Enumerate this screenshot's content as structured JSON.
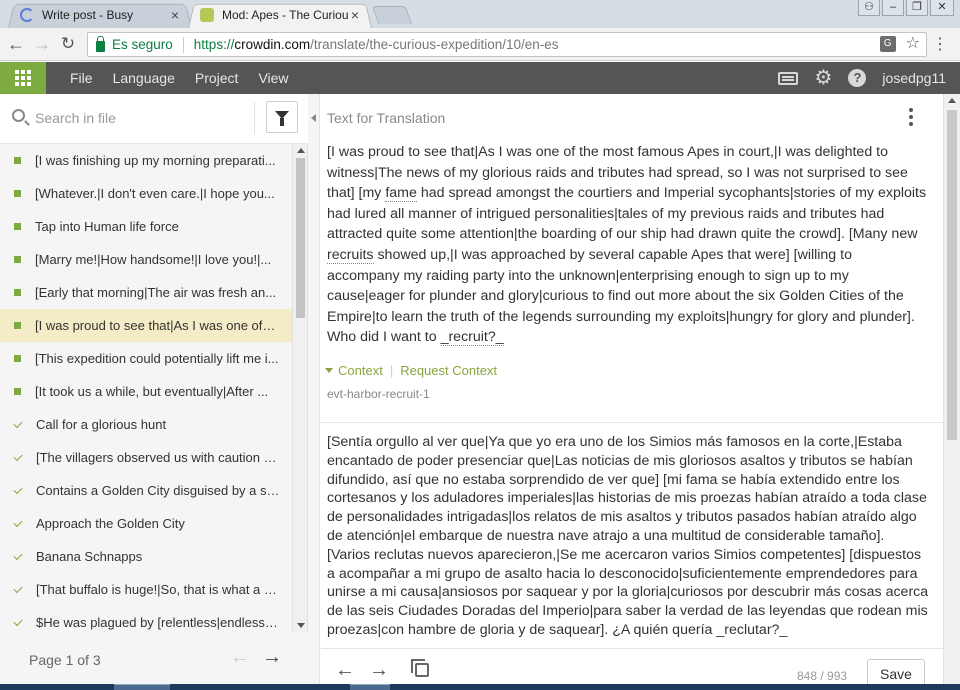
{
  "browser": {
    "tabs": [
      {
        "title": "Write post - Busy",
        "close": "×"
      },
      {
        "title": "Mod: Apes - The Curious",
        "close": "×"
      }
    ],
    "secure_label": "Es seguro",
    "url_scheme": "https://",
    "url_host": "crowdin.com",
    "url_path": "/translate/the-curious-expedition/10/en-es"
  },
  "appnav": {
    "menu": [
      "File",
      "Language",
      "Project",
      "View"
    ],
    "username": "josedpg11"
  },
  "left": {
    "search_placeholder": "Search in file",
    "strings": [
      {
        "text": "[I was finishing up my morning preparati...",
        "status": "untranslated"
      },
      {
        "text": "[Whatever.|I don't even care.|I hope you...",
        "status": "untranslated"
      },
      {
        "text": "Tap into Human life force",
        "status": "untranslated"
      },
      {
        "text": "[Marry me!|How handsome!|I love you!|...",
        "status": "untranslated"
      },
      {
        "text": "[Early that morning|The air was fresh an...",
        "status": "untranslated"
      },
      {
        "text": "[I was proud to see that|As I was one of t...",
        "status": "untranslated"
      },
      {
        "text": "[This expedition could potentially lift me i...",
        "status": "untranslated"
      },
      {
        "text": "[It took us a while, but eventually|After ...",
        "status": "untranslated"
      },
      {
        "text": "Call for a glorious hunt",
        "status": "translated"
      },
      {
        "text": "[The villagers observed us with caution a...",
        "status": "translated"
      },
      {
        "text": "Contains a Golden City disguised by a sh...",
        "status": "translated"
      },
      {
        "text": "Approach the Golden City",
        "status": "translated"
      },
      {
        "text": "Banana Schnapps",
        "status": "translated"
      },
      {
        "text": "[That buffalo is huge!|So, that is what a b...",
        "status": "translated"
      },
      {
        "text": "$He was plagued by [relentless|endless] ...",
        "status": "translated"
      }
    ],
    "selected_index": 5,
    "page_label": "Page 1 of 3"
  },
  "editor": {
    "header": "Text for Translation",
    "source_pre": "[I was proud to see that|As I was one of the most famous Apes in court,|I was delighted to witness|The news of my glorious raids and tributes had spread, so I was not surprised to see that] [my ",
    "source_word1": "fame",
    "source_mid": " had spread amongst the courtiers and Imperial sycophants|stories of my exploits had lured all manner of intrigued personalities|tales of my previous raids and tributes had attracted quite some attention|the boarding of our ship had drawn quite the crowd]. [Many new ",
    "source_word2": "recruits",
    "source_post": " showed up,|I was approached by several capable Apes that were] [willing to accompany my raiding party into the unknown|enterprising enough to sign up to my cause|eager for plunder and glory|curious to find out more about the six Golden Cities of the Empire|to learn the truth of the legends surrounding my exploits|hungry for glory and plunder]. Who did I want to ",
    "source_word3": "_recruit?_",
    "context_label": "Context",
    "request_context_label": "Request Context",
    "string_key": "evt-harbor-recruit-1",
    "translation": "[Sentía orgullo al ver que|Ya que yo era uno de los Simios más famosos en la corte,|Estaba encantado de poder presenciar que|Las noticias de mis gloriosos asaltos y tributos se habían difundido, así que no estaba sorprendido de ver que] [mi fama se había extendido entre los cortesanos y los aduladores imperiales|las historias de mis proezas habían atraído a toda clase de personalidades intrigadas|los relatos de mis asaltos y tributos pasados habían atraído algo de atención|el embarque de nuestra nave atrajo a una multitud de considerable tamaño]. [Varios reclutas nuevos aparecieron,|Se me acercaron varios Simios competentes] [dispuestos a acompañar a mi grupo de asalto hacia lo desconocido|suficientemente emprendedores para unirse a mi causa|ansiosos por saquear y por la gloria|curiosos por descubrir más cosas acerca de las seis Ciudades Doradas del Imperio|para saber la verdad de las leyendas que rodean mis proezas|con hambre de gloria y de saquear]. ¿A quién quería _reclutar?_",
    "char_count": "848 / 993",
    "save_label": "Save"
  },
  "colors": {
    "accent_green": "#7dab3f",
    "nav_bg": "#545556",
    "selected_row": "#f3ecc6"
  }
}
